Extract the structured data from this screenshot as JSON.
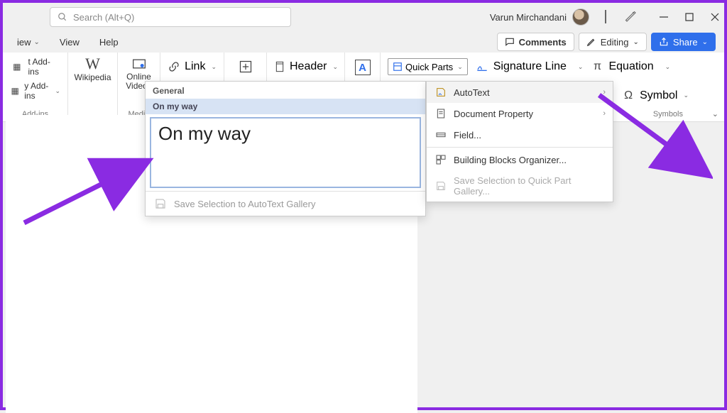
{
  "titlebar": {
    "search_placeholder": "Search (Alt+Q)",
    "user_name": "Varun Mirchandani"
  },
  "tabs": {
    "left_partial": "iew",
    "view": "View",
    "help": "Help"
  },
  "actions": {
    "comments": "Comments",
    "editing": "Editing",
    "share": "Share"
  },
  "ribbon": {
    "addins": {
      "get": "t Add-ins",
      "my": "y Add-ins",
      "group": "Add-ins"
    },
    "wikipedia": "Wikipedia",
    "media": {
      "online_videos": "Online\nVideos",
      "group": "Media"
    },
    "link": "Link",
    "header": "Header",
    "quick_parts": "Quick Parts",
    "signature": "Signature Line",
    "equation": "Equation",
    "symbol": "Symbol",
    "symbols_group": "Symbols"
  },
  "dropdown": {
    "autotext": "AutoText",
    "docprop": "Document Property",
    "field": "Field...",
    "bbo": "Building Blocks Organizer...",
    "save_qp": "Save Selection to Quick Part Gallery..."
  },
  "flyout": {
    "general": "General",
    "entry_title": "On my way",
    "entry_text": "On my way",
    "save_at": "Save Selection to AutoText Gallery"
  }
}
